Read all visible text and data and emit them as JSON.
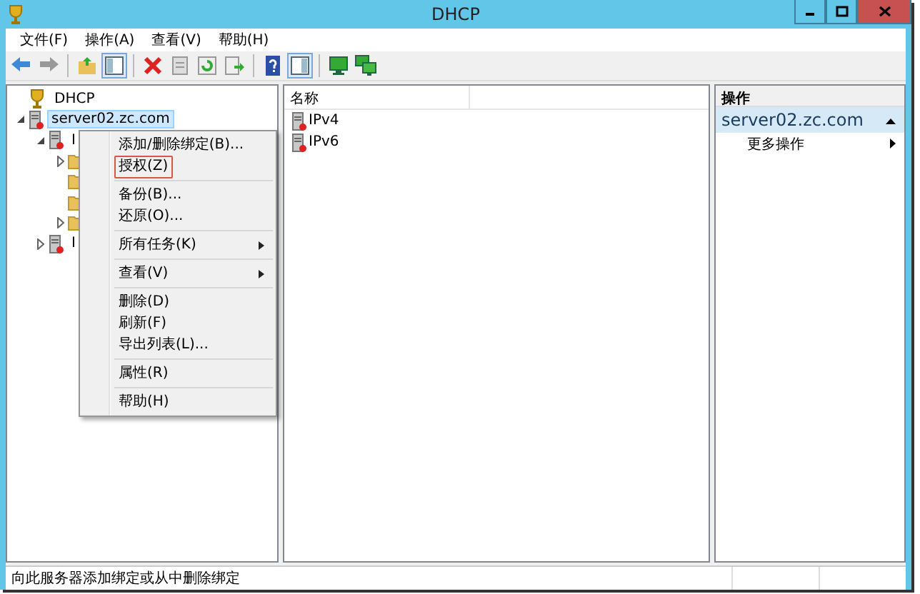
{
  "window": {
    "title": "DHCP"
  },
  "menu_bar": [
    {
      "label": "文件(F)"
    },
    {
      "label": "操作(A)"
    },
    {
      "label": "查看(V)"
    },
    {
      "label": "帮助(H)"
    }
  ],
  "toolbar": [
    {
      "kind": "back",
      "pressed": false
    },
    {
      "kind": "forward",
      "pressed": false
    },
    {
      "kind": "sep"
    },
    {
      "kind": "up",
      "pressed": false
    },
    {
      "kind": "pane",
      "pressed": true
    },
    {
      "kind": "sep"
    },
    {
      "kind": "delete",
      "pressed": false
    },
    {
      "kind": "properties",
      "pressed": false
    },
    {
      "kind": "refresh",
      "pressed": false
    },
    {
      "kind": "export",
      "pressed": false
    },
    {
      "kind": "sep"
    },
    {
      "kind": "help",
      "pressed": false
    },
    {
      "kind": "actionpane",
      "pressed": true
    },
    {
      "kind": "sep"
    },
    {
      "kind": "monitor",
      "pressed": false
    },
    {
      "kind": "monitors",
      "pressed": false
    }
  ],
  "tree": [
    {
      "kind": "root",
      "label": "DHCP",
      "selected": false,
      "children": [
        {
          "kind": "server",
          "label": "server02.zc.com",
          "selected": true,
          "expanded": true,
          "children": [
            {
              "kind": "server",
              "label": "I",
              "selected": false,
              "expanded": true,
              "children": [
                {
                  "kind": "folder",
                  "expanded": false
                },
                {
                  "kind": "folder"
                },
                {
                  "kind": "folder"
                },
                {
                  "kind": "folder",
                  "expanded": false
                }
              ]
            },
            {
              "kind": "server",
              "label": "I",
              "selected": false,
              "expanded": false
            }
          ]
        }
      ]
    }
  ],
  "list": {
    "columns": [
      "名称"
    ],
    "rows": [
      {
        "name": "IPv4"
      },
      {
        "name": "IPv6"
      }
    ]
  },
  "actions": {
    "header": "操作",
    "section": "server02.zc.com",
    "items": [
      {
        "label": "更多操作",
        "submenu": true
      }
    ]
  },
  "context_menu": {
    "groups": [
      [
        {
          "label": "添加/删除绑定(B)...",
          "submenu": false,
          "highlighted": false
        },
        {
          "label": "授权(Z)",
          "submenu": false,
          "highlighted": true
        }
      ],
      [
        {
          "label": "备份(B)...",
          "submenu": false,
          "highlighted": false
        },
        {
          "label": "还原(O)...",
          "submenu": false,
          "highlighted": false
        }
      ],
      [
        {
          "label": "所有任务(K)",
          "submenu": true,
          "highlighted": false
        }
      ],
      [
        {
          "label": "查看(V)",
          "submenu": true,
          "highlighted": false
        }
      ],
      [
        {
          "label": "删除(D)",
          "submenu": false,
          "highlighted": false
        },
        {
          "label": "刷新(F)",
          "submenu": false,
          "highlighted": false
        },
        {
          "label": "导出列表(L)...",
          "submenu": false,
          "highlighted": false
        }
      ],
      [
        {
          "label": "属性(R)",
          "submenu": false,
          "highlighted": false
        }
      ],
      [
        {
          "label": "帮助(H)",
          "submenu": false,
          "highlighted": false
        }
      ]
    ]
  },
  "status_bar": {
    "text": "向此服务器添加绑定或从中删除绑定"
  }
}
